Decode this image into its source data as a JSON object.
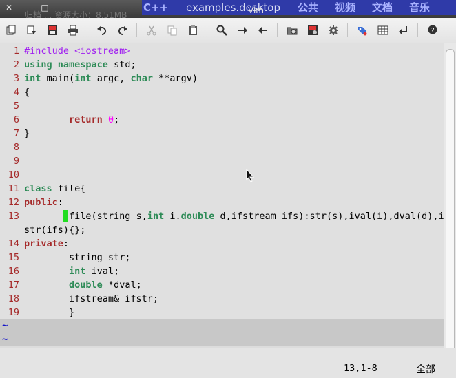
{
  "window": {
    "title": "Vim"
  },
  "background": {
    "ghost_text": "归档 ... 资源大小：8.51MB",
    "tag": "C++",
    "file": "examples.desktop",
    "tabs": [
      "公共",
      "视频",
      "文档",
      "音乐"
    ]
  },
  "toolbar": {
    "icons": [
      "open-icon",
      "load-session-icon",
      "save-icon",
      "print-icon",
      "undo-icon",
      "redo-icon",
      "cut-icon",
      "copy-icon",
      "paste-icon",
      "find-icon",
      "find-next-icon",
      "find-prev-icon",
      "run-script-icon",
      "make-icon",
      "settings-icon",
      "tags-icon",
      "table-icon",
      "jump-icon",
      "help-icon"
    ]
  },
  "editor": {
    "line_numbers": [
      "1",
      "2",
      "3",
      "4",
      "5",
      "6",
      "7",
      "8",
      "9",
      "10",
      "11",
      "12",
      "13",
      "",
      "14",
      "15",
      "16",
      "17",
      "18",
      "19"
    ],
    "lines": [
      {
        "segments": [
          {
            "t": "#include ",
            "c": "pp"
          },
          {
            "t": "<iostream>",
            "c": "pp"
          }
        ]
      },
      {
        "segments": [
          {
            "t": "using",
            "c": "ty"
          },
          {
            "t": " "
          },
          {
            "t": "namespace",
            "c": "ty"
          },
          {
            "t": " std;"
          }
        ]
      },
      {
        "segments": [
          {
            "t": "int",
            "c": "ty"
          },
          {
            "t": " main("
          },
          {
            "t": "int",
            "c": "ty"
          },
          {
            "t": " argc, "
          },
          {
            "t": "char",
            "c": "ty"
          },
          {
            "t": " **argv)"
          }
        ]
      },
      {
        "segments": [
          {
            "t": "{"
          }
        ]
      },
      {
        "segments": []
      },
      {
        "segments": [
          {
            "t": "        "
          },
          {
            "t": "return",
            "c": "kw"
          },
          {
            "t": " "
          },
          {
            "t": "0",
            "c": "num"
          },
          {
            "t": ";"
          }
        ]
      },
      {
        "segments": [
          {
            "t": "}"
          }
        ]
      },
      {
        "segments": []
      },
      {
        "segments": []
      },
      {
        "segments": []
      },
      {
        "segments": [
          {
            "t": "class",
            "c": "ty"
          },
          {
            "t": " file{"
          }
        ]
      },
      {
        "segments": [
          {
            "t": "public",
            "c": "kw"
          },
          {
            "t": ":"
          }
        ]
      },
      {
        "segments": [
          {
            "t": "        ",
            "c": "cursor-pad"
          },
          {
            "t": "file(string s,"
          },
          {
            "t": "int",
            "c": "ty"
          },
          {
            "t": " i."
          },
          {
            "t": "double",
            "c": "ty"
          },
          {
            "t": " d,ifstream ifs):str(s),ival(i),dval(d),if"
          }
        ]
      },
      {
        "segments": [
          {
            "t": "str(ifs){};"
          }
        ]
      },
      {
        "segments": [
          {
            "t": "private",
            "c": "kw"
          },
          {
            "t": ":"
          }
        ]
      },
      {
        "segments": [
          {
            "t": "        string str;"
          }
        ]
      },
      {
        "segments": [
          {
            "t": "        "
          },
          {
            "t": "int",
            "c": "ty"
          },
          {
            "t": " ival;"
          }
        ]
      },
      {
        "segments": [
          {
            "t": "        "
          },
          {
            "t": "double",
            "c": "ty"
          },
          {
            "t": " *dval;"
          }
        ]
      },
      {
        "segments": [
          {
            "t": "        ifstream& ifstr;"
          }
        ]
      },
      {
        "segments": [
          {
            "t": "        }"
          }
        ]
      }
    ],
    "filler": [
      "~",
      "~"
    ]
  },
  "status": {
    "position": "13,1-8",
    "percent": "全部"
  },
  "colors": {
    "editor_bg": "#e0e0e0",
    "line_number": "#a52a2a",
    "keyword": "#a52a2a",
    "type": "#2e8b57",
    "preproc": "#a020f0",
    "number": "#ff00ff",
    "cursor": "#22dd22"
  }
}
